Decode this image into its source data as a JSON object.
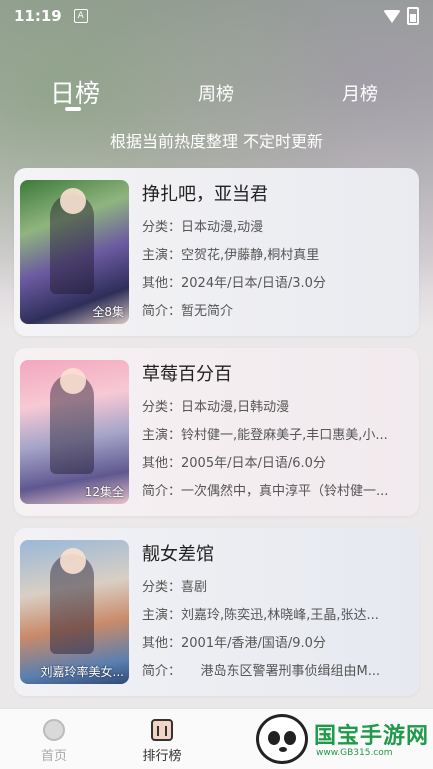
{
  "status_bar": {
    "time": "11:19",
    "notif_letter": "A"
  },
  "tabs": [
    {
      "label": "日榜",
      "active": true
    },
    {
      "label": "周榜",
      "active": false
    },
    {
      "label": "月榜",
      "active": false
    }
  ],
  "subtitle": "根据当前热度整理 不定时更新",
  "items": [
    {
      "title": "挣扎吧，亚当君",
      "badge": "全8集",
      "category": "分类：日本动漫,动漫",
      "cast": "主演：空贺花,伊藤静,桐村真里",
      "other": "其他：2024年/日本/日语/3.0分",
      "intro": "简介：暂无简介"
    },
    {
      "title": "草莓百分百",
      "badge": "12集全",
      "category": "分类：日本动漫,日韩动漫",
      "cast": "主演：铃村健一,能登麻美子,丰口惠美,小...",
      "other": "其他：2005年/日本/日语/6.0分",
      "intro": "简介：一次偶然中，真中淳平（铃村健一..."
    },
    {
      "title": "靓女差馆",
      "badge": "刘嘉玲率美女...",
      "category": "分类：喜剧",
      "cast": "主演：刘嘉玲,陈奕迅,林晓峰,王晶,张达...",
      "other": "其他：2001年/香港/国语/9.0分",
      "intro": "简介：　　港岛东区警署刑事侦缉组由M..."
    }
  ],
  "bottom_nav": [
    {
      "label": "首页",
      "icon": "home-icon",
      "active": false
    },
    {
      "label": "排行榜",
      "icon": "ranking-icon",
      "active": true
    }
  ],
  "watermark": {
    "text": "国宝手游网",
    "url": "www.GB315.com"
  },
  "colors": {
    "accent_green": "#1f9a4a",
    "card_bg": "#f4f3f5"
  }
}
